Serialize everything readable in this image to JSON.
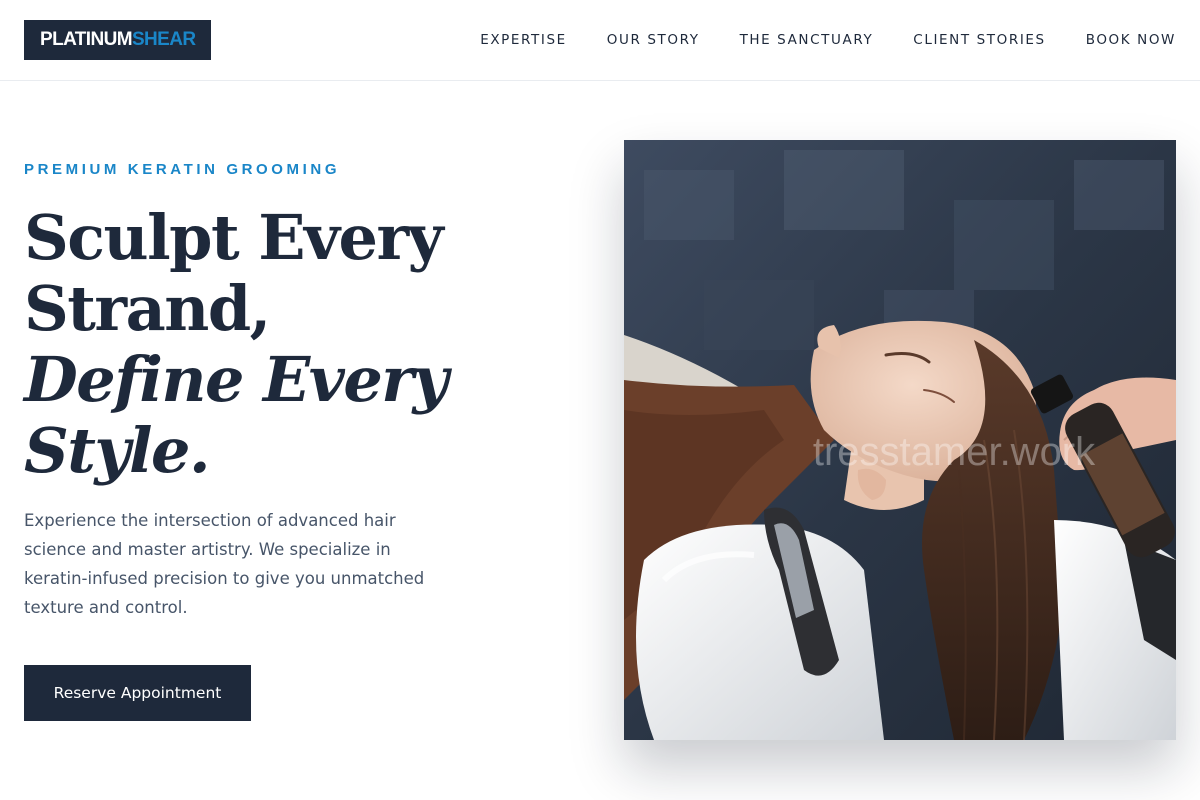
{
  "brand": {
    "name_main": "PLATINUM",
    "name_accent": "SHEAR"
  },
  "nav": {
    "items": [
      {
        "label": "EXPERTISE"
      },
      {
        "label": "OUR STORY"
      },
      {
        "label": "THE SANCTUARY"
      },
      {
        "label": "CLIENT STORIES"
      },
      {
        "label": "BOOK NOW"
      }
    ]
  },
  "hero": {
    "eyebrow": "PREMIUM KERATIN GROOMING",
    "headline": {
      "line1": "Sculpt Every",
      "line2": "Strand,",
      "line3": "Define Every",
      "line4": "Style."
    },
    "description": "Experience the intersection of advanced hair science and master artistry. We specialize in keratin-infused precision to give you unmatched texture and control.",
    "cta_label": "Reserve Appointment",
    "image": {
      "watermark": "tresstamer.work"
    }
  },
  "colors": {
    "navy": "#1e293b",
    "accent_blue": "#1a86c8",
    "body_text": "#475569",
    "background": "#ffffff"
  }
}
